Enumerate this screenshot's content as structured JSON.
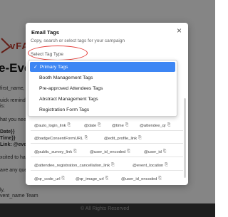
{
  "background": {
    "logo_text": "vFA",
    "title": "e-Event",
    "lines": [
      "first_name,",
      "uick remind",
      "is:",
      "hat you nee",
      "Date}}",
      "Time}}",
      "Link: @eve",
      "xcited to ha",
      "ave any que",
      "ly,",
      "vent_name Team"
    ],
    "footer": "© All Rights Reserved"
  },
  "modal": {
    "title": "Email Tags",
    "close_symbol": "×",
    "subtitle": "Copy, search or select tags for your campaign",
    "tag_type_label": "Select Tag Type"
  },
  "dropdown": {
    "options": [
      {
        "label": "Primary Tags",
        "selected": true
      },
      {
        "label": "Booth Management Tags",
        "selected": false
      },
      {
        "label": "Pre-approved Attendees Tags",
        "selected": false
      },
      {
        "label": "Abstract Management Tags",
        "selected": false
      },
      {
        "label": "Registration Form Tags",
        "selected": false
      }
    ],
    "check_symbol": "✓"
  },
  "tags": {
    "row1": [
      "@auto_login_link",
      "@date",
      "@time",
      "@attendee_qr"
    ],
    "row2": [
      "@badgeConsentFormURL",
      "@edit_profile_link"
    ],
    "row3": [
      "@public_survey_link",
      "@user_id_encoded",
      "@user_id"
    ],
    "row4": [
      "@attendee_registration_cancellation_link",
      "@event_location"
    ],
    "row5": [
      "@qr_code_url",
      "@qr_image_url",
      "@user_id_encoded"
    ]
  },
  "colors": {
    "accent": "#3d86f4",
    "highlight_ring": "#e53935",
    "brand_logo": "#c0392b"
  }
}
